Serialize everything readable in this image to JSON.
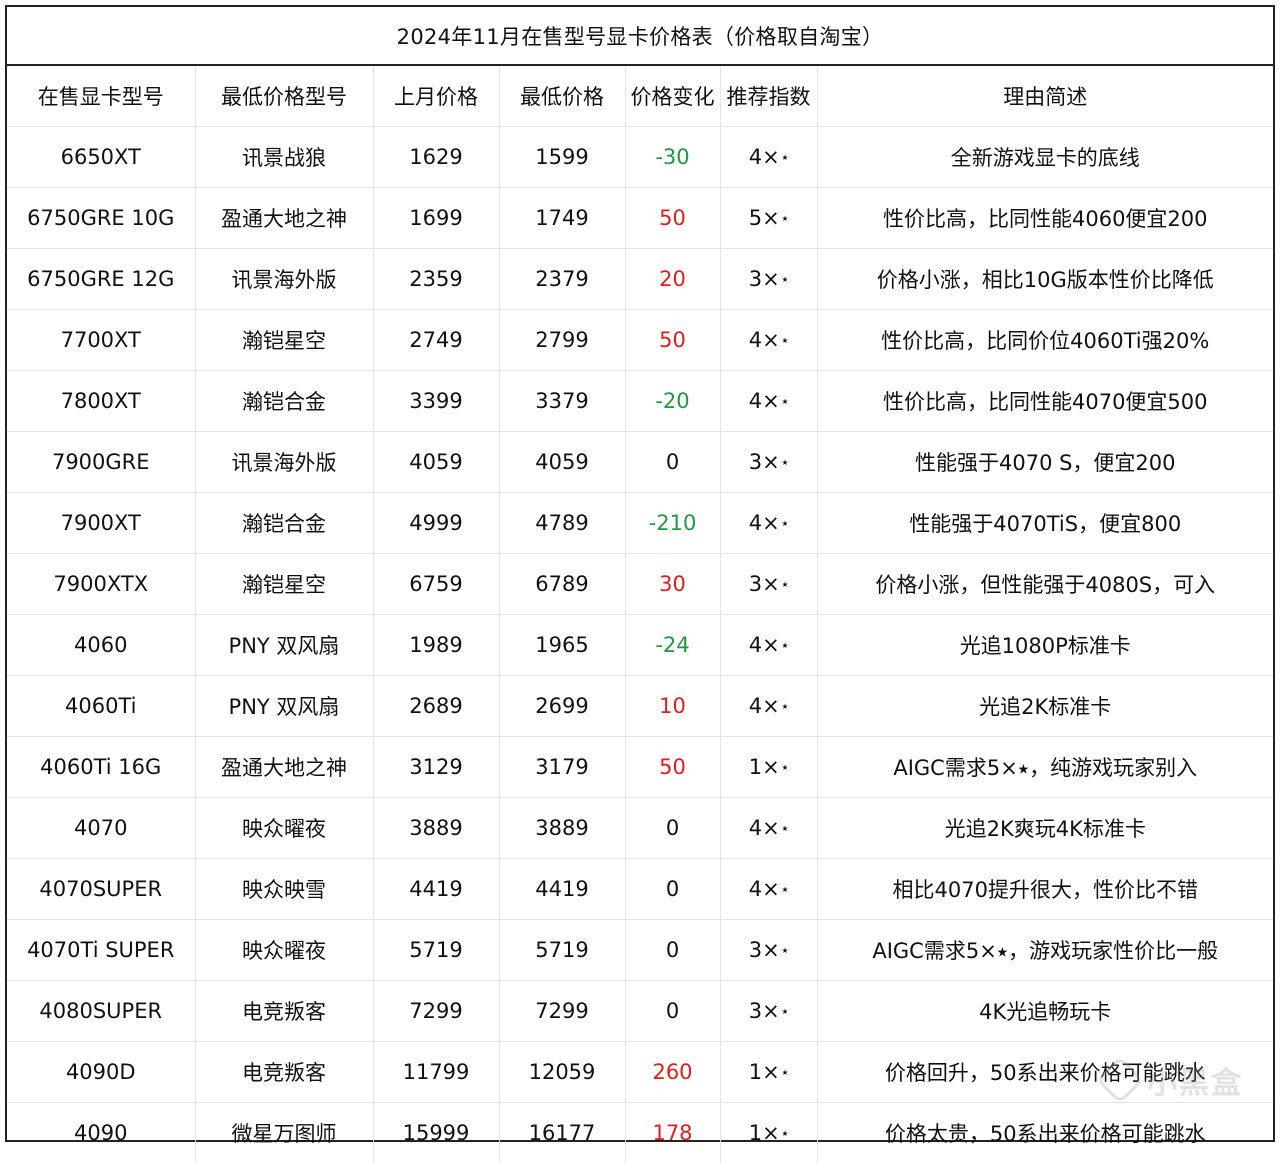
{
  "title": "2024年11月在售型号显卡价格表（价格取自淘宝）",
  "columns": [
    "在售显卡型号",
    "最低价格型号",
    "上月价格",
    "最低价格",
    "价格变化",
    "推荐指数",
    "理由简述"
  ],
  "star_symbol": "⭑",
  "colors": {
    "price_drop": "#1f9a3c",
    "price_rise": "#e11d1d",
    "no_change": "#111111"
  },
  "rows": [
    {
      "model": "6650XT",
      "variant": "讯景战狼",
      "last_month": "1629",
      "lowest": "1599",
      "change": "-30",
      "trend": "down",
      "rating": "4×",
      "reason": "全新游戏显卡的底线"
    },
    {
      "model": "6750GRE 10G",
      "variant": "盈通大地之神",
      "last_month": "1699",
      "lowest": "1749",
      "change": "50",
      "trend": "up",
      "rating": "5×",
      "reason": "性价比高，比同性能4060便宜200"
    },
    {
      "model": "6750GRE 12G",
      "variant": "讯景海外版",
      "last_month": "2359",
      "lowest": "2379",
      "change": "20",
      "trend": "up",
      "rating": "3×",
      "reason": "价格小涨，相比10G版本性价比降低"
    },
    {
      "model": "7700XT",
      "variant": "瀚铠星空",
      "last_month": "2749",
      "lowest": "2799",
      "change": "50",
      "trend": "up",
      "rating": "4×",
      "reason": "性价比高，比同价位4060Ti强20%"
    },
    {
      "model": "7800XT",
      "variant": "瀚铠合金",
      "last_month": "3399",
      "lowest": "3379",
      "change": "-20",
      "trend": "down",
      "rating": "4×",
      "reason": "性价比高，比同性能4070便宜500"
    },
    {
      "model": "7900GRE",
      "variant": "讯景海外版",
      "last_month": "4059",
      "lowest": "4059",
      "change": "0",
      "trend": "flat",
      "rating": "3×",
      "reason": "性能强于4070 S，便宜200"
    },
    {
      "model": "7900XT",
      "variant": "瀚铠合金",
      "last_month": "4999",
      "lowest": "4789",
      "change": "-210",
      "trend": "down",
      "rating": "4×",
      "reason": "性能强于4070TiS，便宜800"
    },
    {
      "model": "7900XTX",
      "variant": "瀚铠星空",
      "last_month": "6759",
      "lowest": "6789",
      "change": "30",
      "trend": "up",
      "rating": "3×",
      "reason": "价格小涨，但性能强于4080S，可入"
    },
    {
      "model": "4060",
      "variant": "PNY 双风扇",
      "last_month": "1989",
      "lowest": "1965",
      "change": "-24",
      "trend": "down",
      "rating": "4×",
      "reason": "光追1080P标准卡"
    },
    {
      "model": "4060Ti",
      "variant": "PNY 双风扇",
      "last_month": "2689",
      "lowest": "2699",
      "change": "10",
      "trend": "up",
      "rating": "4×",
      "reason": "光追2K标准卡"
    },
    {
      "model": "4060Ti 16G",
      "variant": "盈通大地之神",
      "last_month": "3129",
      "lowest": "3179",
      "change": "50",
      "trend": "up",
      "rating": "1×",
      "reason": "AIGC需求5×⭑，纯游戏玩家别入"
    },
    {
      "model": "4070",
      "variant": "映众曜夜",
      "last_month": "3889",
      "lowest": "3889",
      "change": "0",
      "trend": "flat",
      "rating": "4×",
      "reason": "光追2K爽玩4K标准卡"
    },
    {
      "model": "4070SUPER",
      "variant": "映众映雪",
      "last_month": "4419",
      "lowest": "4419",
      "change": "0",
      "trend": "flat",
      "rating": "4×",
      "reason": "相比4070提升很大，性价比不错"
    },
    {
      "model": "4070Ti SUPER",
      "variant": "映众曜夜",
      "last_month": "5719",
      "lowest": "5719",
      "change": "0",
      "trend": "flat",
      "rating": "3×",
      "reason": "AIGC需求5×⭑，游戏玩家性价比一般"
    },
    {
      "model": "4080SUPER",
      "variant": "电竞叛客",
      "last_month": "7299",
      "lowest": "7299",
      "change": "0",
      "trend": "flat",
      "rating": "3×",
      "reason": "4K光追畅玩卡"
    },
    {
      "model": "4090D",
      "variant": "电竞叛客",
      "last_month": "11799",
      "lowest": "12059",
      "change": "260",
      "trend": "up",
      "rating": "1×",
      "reason": "价格回升，50系出来价格可能跳水"
    },
    {
      "model": "4090",
      "variant": "微星万图师",
      "last_month": "15999",
      "lowest": "16177",
      "change": "178",
      "trend": "up",
      "rating": "1×",
      "reason": "价格太贵，50系出来价格可能跳水"
    }
  ],
  "watermark": "小黑盒"
}
